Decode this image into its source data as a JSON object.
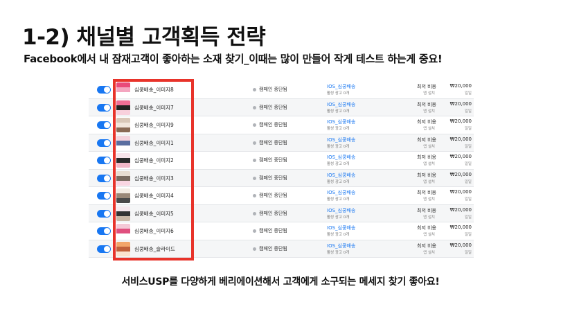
{
  "title": "1-2)  채널별 고객획득 전략",
  "subtitle": "Facebook에서 내 잠재고객이 좋아하는 소재 찾기_이때는 많이 만들어 작게 테스트 하는게 중요!",
  "footer": "서비스USP를 다양하게 베리에이션해서 고객에게 소구되는 메세지 찾기 좋아요!",
  "colors": {
    "accent": "#1877f2",
    "highlight": "#e8332a"
  },
  "rows": [
    {
      "name": "심쿵배송_이미지8",
      "status": "캠페인 중단됨",
      "campaign": "IOS_심쿵배송",
      "active_ads": "활성 광고 0개",
      "bid": "최저 비용",
      "bid_sub": "앱 설치",
      "budget": "₩20,000",
      "budget_sub": "일일",
      "thumb": [
        "#e94a7a",
        "#f4a6c0",
        "#ffffff"
      ]
    },
    {
      "name": "심쿵배송_이미지7",
      "status": "캠페인 중단됨",
      "campaign": "IOS_심쿵배송",
      "active_ads": "활성 광고 0개",
      "bid": "최저 비용",
      "bid_sub": "앱 설치",
      "budget": "₩20,000",
      "budget_sub": "일일",
      "thumb": [
        "#f06e96",
        "#222222",
        "#f8d0dc"
      ]
    },
    {
      "name": "심쿵배송_이미지9",
      "status": "캠페인 중단됨",
      "campaign": "IOS_심쿵배송",
      "active_ads": "활성 광고 0개",
      "bid": "최저 비용",
      "bid_sub": "앱 설치",
      "budget": "₩20,000",
      "budget_sub": "일일",
      "thumb": [
        "#d9c7b8",
        "#f2e6dc",
        "#8a6a55"
      ]
    },
    {
      "name": "심쿵배송_이미지1",
      "status": "캠페인 중단됨",
      "campaign": "IOS_심쿵배송",
      "active_ads": "활성 광고 0개",
      "bid": "최저 비용",
      "bid_sub": "앱 설치",
      "budget": "₩20,000",
      "budget_sub": "일일",
      "thumb": [
        "#f4d3dd",
        "#5a6ea0",
        "#ffffff"
      ]
    },
    {
      "name": "심쿵배송_이미지2",
      "status": "캠페인 중단됨",
      "campaign": "IOS_심쿵배송",
      "active_ads": "활성 광고 0개",
      "bid": "최저 비용",
      "bid_sub": "앱 설치",
      "budget": "₩20,000",
      "budget_sub": "일일",
      "thumb": [
        "#f7e4ea",
        "#2b2b2b",
        "#f2b8c8"
      ]
    },
    {
      "name": "심쿵배송_이미지3",
      "status": "캠페인 중단됨",
      "campaign": "IOS_심쿵배송",
      "active_ads": "활성 광고 0개",
      "bid": "최저 비용",
      "bid_sub": "앱 설치",
      "budget": "₩20,000",
      "budget_sub": "일일",
      "thumb": [
        "#e8ddd2",
        "#7a6b60",
        "#f9d6e2"
      ]
    },
    {
      "name": "심쿵배송_이미지4",
      "status": "캠페인 중단됨",
      "campaign": "IOS_심쿵배송",
      "active_ads": "활성 광고 0개",
      "bid": "최저 비용",
      "bid_sub": "앱 설치",
      "budget": "₩20,000",
      "budget_sub": "일일",
      "thumb": [
        "#f3ece4",
        "#9a8878",
        "#4a4a4a"
      ]
    },
    {
      "name": "심쿵배송_이미지5",
      "status": "캠페인 중단됨",
      "campaign": "IOS_심쿵배송",
      "active_ads": "활성 광고 0개",
      "bid": "최저 비용",
      "bid_sub": "앱 설치",
      "budget": "₩20,000",
      "budget_sub": "일일",
      "thumb": [
        "#f6e9ee",
        "#333333",
        "#c9b7a6"
      ]
    },
    {
      "name": "심쿵배송_이미지6",
      "status": "캠페인 중단됨",
      "campaign": "IOS_심쿵배송",
      "active_ads": "활성 광고 0개",
      "bid": "최저 비용",
      "bid_sub": "앱 설치",
      "budget": "₩20,000",
      "budget_sub": "일일",
      "thumb": [
        "#f4c8d6",
        "#e0507e",
        "#ffffff"
      ]
    },
    {
      "name": "심쿵배송_슬라이드",
      "status": "캠페인 중단됨",
      "campaign": "IOS_심쿵배송",
      "active_ads": "활성 광고 0개",
      "bid": "최저 비용",
      "bid_sub": "앱 설치",
      "budget": "₩20,000",
      "budget_sub": "일일",
      "thumb": [
        "#f2a56a",
        "#c0603a",
        "#fbe3cf"
      ]
    }
  ]
}
